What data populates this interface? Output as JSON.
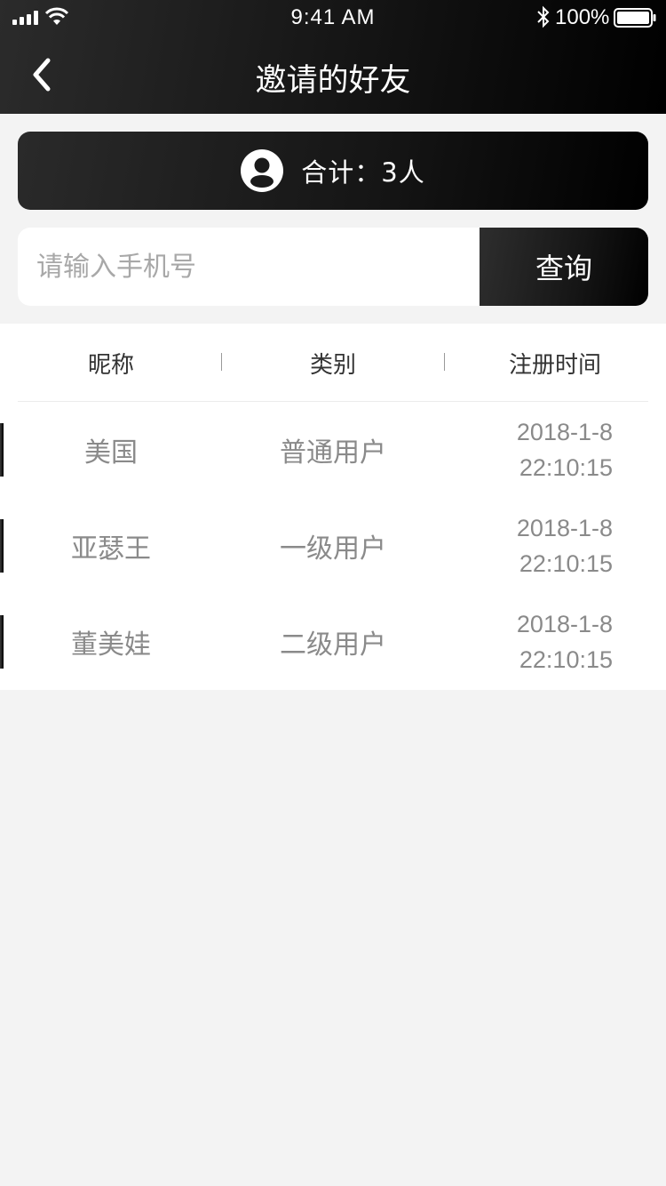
{
  "status_bar": {
    "time": "9:41 AM",
    "battery": "100%",
    "icons": [
      "signal-icon",
      "wifi-icon",
      "bluetooth-icon",
      "battery-icon"
    ]
  },
  "header": {
    "title": "邀请的好友",
    "back_icon": "chevron-left-icon"
  },
  "summary": {
    "icon": "user-circle-icon",
    "text": "合计：3人"
  },
  "search": {
    "placeholder": "请输入手机号",
    "value": "",
    "button_label": "查询"
  },
  "table": {
    "columns": [
      "昵称",
      "类别",
      "注册时间"
    ],
    "rows": [
      {
        "nickname": "美国",
        "category": "普通用户",
        "date": "2018-1-8",
        "time": "22:10:15"
      },
      {
        "nickname": "亚瑟王",
        "category": "一级用户",
        "date": "2018-1-8",
        "time": "22:10:15"
      },
      {
        "nickname": "董美娃",
        "category": "二级用户",
        "date": "2018-1-8",
        "time": "22:10:15"
      }
    ]
  },
  "colors": {
    "header_gradient_start": "#2b2b2b",
    "header_gradient_end": "#000000",
    "page_background": "#f3f3f3",
    "cell_text": "#8a8a8a"
  }
}
